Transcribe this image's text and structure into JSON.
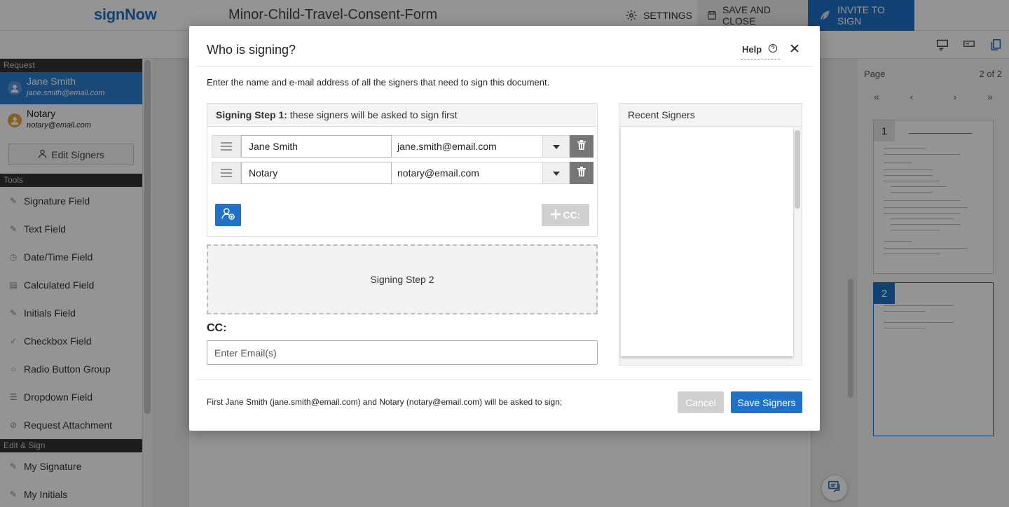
{
  "app": {
    "logo": "signNow",
    "document_title": "Minor-Child-Travel-Consent-Form"
  },
  "toolbar": {
    "settings_label": "SETTINGS",
    "save_close_label": "SAVE AND CLOSE",
    "invite_label": "INVITE TO SIGN"
  },
  "sidebar": {
    "request_header": "Request",
    "signers": [
      {
        "name": "Jane Smith",
        "email": "jane.smith@email.com",
        "color": "#2a7fd0"
      },
      {
        "name": "Notary",
        "email": "notary@email.com",
        "color": "#e8a53a"
      }
    ],
    "edit_signers_label": "Edit Signers",
    "tools_header": "Tools",
    "tools": [
      {
        "label": "Signature Field",
        "icon": "pen-icon"
      },
      {
        "label": "Text Field",
        "icon": "text-icon"
      },
      {
        "label": "Date/Time Field",
        "icon": "clock-icon"
      },
      {
        "label": "Calculated Field",
        "icon": "calculator-icon"
      },
      {
        "label": "Initials Field",
        "icon": "pen-icon"
      },
      {
        "label": "Checkbox Field",
        "icon": "check-icon"
      },
      {
        "label": "Radio Button Group",
        "icon": "radio-icon"
      },
      {
        "label": "Dropdown Field",
        "icon": "list-icon"
      },
      {
        "label": "Request Attachment",
        "icon": "paperclip-icon"
      }
    ],
    "edit_sign_header": "Edit & Sign",
    "edit_sign_tools": [
      {
        "label": "My Signature",
        "icon": "pen-icon"
      },
      {
        "label": "My Initials",
        "icon": "pen-icon"
      }
    ]
  },
  "pages_panel": {
    "label": "Page",
    "count": "2 of 2",
    "thumbnails": [
      "1",
      "2"
    ]
  },
  "modal": {
    "title": "Who is signing?",
    "help_label": "Help",
    "description": "Enter the name and e-mail address of all the signers that need to sign this document.",
    "step1": {
      "title_bold": "Signing Step 1:",
      "title_rest": " these signers will be asked to sign first",
      "signers": [
        {
          "name": "Jane Smith",
          "email": "jane.smith@email.com"
        },
        {
          "name": "Notary",
          "email": "notary@email.com"
        }
      ],
      "cc_button_label": "CC:"
    },
    "step2_label": "Signing Step 2",
    "cc_label": "CC:",
    "cc_placeholder": "Enter Email(s)",
    "recent_signers_title": "Recent Signers",
    "summary": "First Jane Smith (jane.smith@email.com) and Notary (notary@email.com) will be asked to sign;",
    "cancel_label": "Cancel",
    "save_label": "Save Signers"
  }
}
